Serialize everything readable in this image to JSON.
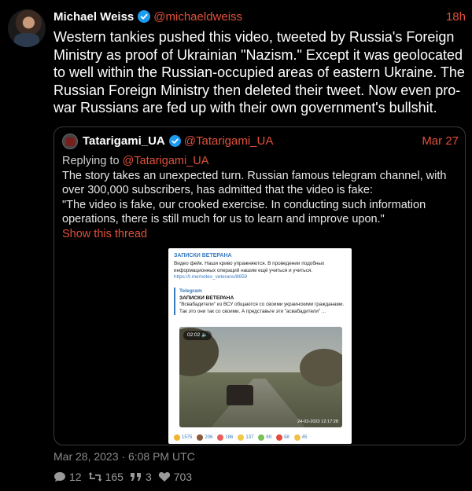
{
  "tweet": {
    "author_name": "Michael Weiss",
    "handle": "@michaeldweiss",
    "time": "18h",
    "text": "Western tankies pushed this video, tweeted by Russia's Foreign Ministry as proof of Ukrainian \"Nazism.\" Except it was geolocated to well within the Russian-occupied areas of eastern Ukraine. The Russian Foreign Ministry then deleted their tweet. Now even pro-war Russians are fed up with their own government's bullshit.",
    "date": "Mar 28, 2023 · 6:08 PM UTC",
    "stats": {
      "replies": "12",
      "retweets": "165",
      "quotes": "3",
      "likes": "703"
    }
  },
  "quote": {
    "author_name": "Tatarigami_UA",
    "handle": "@Tatarigami_UA",
    "time": "Mar 27",
    "replying_prefix": "Replying to ",
    "replying_to": "@Tatarigami_UA",
    "text_1": "The story takes an unexpected turn. Russian famous telegram channel, with over 300,000 subscribers, has admitted that the video is fake:",
    "text_2": "\"The video is fake, our crooked exercise. In conducting such information operations, there is still much for us to learn and improve upon.\"",
    "show_thread": "Show this thread"
  },
  "media": {
    "title": "ЗАПИСКИ ВЕТЕРАНА",
    "text": "Видео фейк. Наши криво упражняются. В проведении подобных информационных операций нашим ещё учиться и учиться.",
    "link": "https://t.me/notes_veterans/8659",
    "tg_label": "Telegram",
    "tg_name": "ЗАПИСКИ ВЕТЕРАНА",
    "tg_text": "\"Всвабадители\" из ВСУ общаются со своими украинскими гражданами. Так это они так со своими. А представьте эти \"асвабадители\" ...",
    "video_duration": "02:02",
    "video_stamp": "24-03-2023 12:17:28",
    "reactions": [
      {
        "emoji": "thinking",
        "count": "1575",
        "color": "#f2b233"
      },
      {
        "emoji": "poop",
        "count": "206",
        "color": "#8a5a3a"
      },
      {
        "emoji": "clown",
        "count": "186",
        "color": "#e85d5d"
      },
      {
        "emoji": "thumbs-up",
        "count": "137",
        "color": "#f2c84b"
      },
      {
        "emoji": "face-vomit",
        "count": "69",
        "color": "#7bbf5a"
      },
      {
        "emoji": "angry",
        "count": "58",
        "color": "#e44b3a"
      },
      {
        "emoji": "shocked",
        "count": "45",
        "color": "#f0c04a"
      }
    ]
  },
  "colors": {
    "accent": "#e0513a",
    "background": "#000000",
    "muted": "#8a8a8a",
    "verified": "#1d9bf0"
  }
}
